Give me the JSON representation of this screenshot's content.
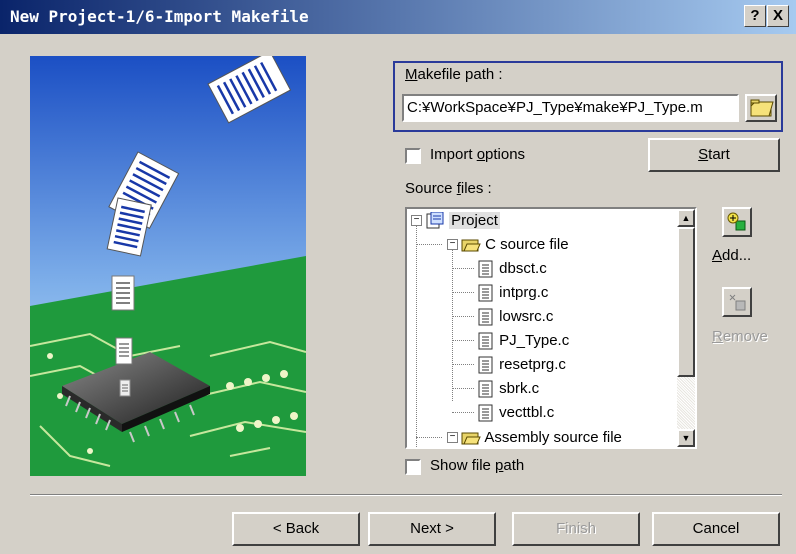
{
  "window": {
    "title": "New Project-1/6-Import Makefile",
    "help_button": "?",
    "close_button": "X"
  },
  "makefile": {
    "label": "Makefile path :",
    "path_value": "C:¥WorkSpace¥PJ_Type¥make¥PJ_Type.m",
    "browse_icon": "folder-icon"
  },
  "import_options": {
    "label": "Import options",
    "checked": false
  },
  "start_button": "Start",
  "source_files": {
    "label": "Source files :",
    "tree": {
      "root": "Project",
      "group1": "C source file",
      "files": [
        "dbsct.c",
        "intprg.c",
        "lowsrc.c",
        "PJ_Type.c",
        "resetprg.c",
        "sbrk.c",
        "vecttbl.c"
      ],
      "group2": "Assembly source file"
    }
  },
  "side_buttons": {
    "add": "Add...",
    "remove": "Remove"
  },
  "show_file_path": {
    "label": "Show file path",
    "checked": false
  },
  "footer": {
    "back": "< Back",
    "next": "Next >",
    "finish": "Finish",
    "cancel": "Cancel"
  },
  "colors": {
    "title_start": "#0a246a",
    "title_end": "#a6caf0",
    "face": "#d4d0c8",
    "focus_border": "#2a3a9a"
  }
}
